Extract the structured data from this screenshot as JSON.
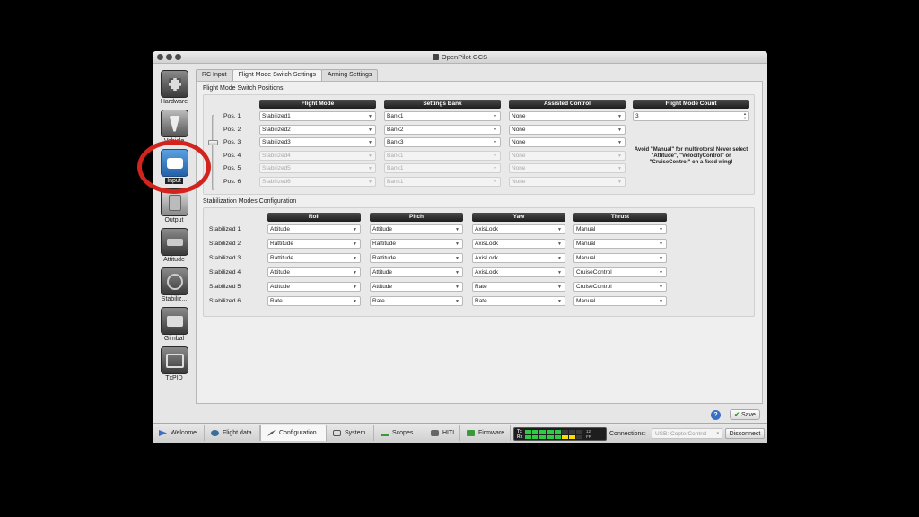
{
  "window": {
    "title": "OpenPilot GCS"
  },
  "sidebar": {
    "items": [
      {
        "label": "Hardware",
        "icon": "chip-icon"
      },
      {
        "label": "Vehicle",
        "icon": "vehicle-icon"
      },
      {
        "label": "Input",
        "icon": "remote-control-icon",
        "active": true
      },
      {
        "label": "Output",
        "icon": "motor-icon"
      },
      {
        "label": "Attitude",
        "icon": "attitude-icon"
      },
      {
        "label": "Stabiliz...",
        "icon": "gyro-icon"
      },
      {
        "label": "Gimbal",
        "icon": "camera-icon"
      },
      {
        "label": "TxPID",
        "icon": "pid-icon"
      }
    ]
  },
  "tabs": [
    "RC Input",
    "Flight Mode Switch Settings",
    "Arming Settings"
  ],
  "flight_mode": {
    "section_title": "Flight Mode Switch Positions",
    "headers": [
      "Flight Mode",
      "Settings Bank",
      "Assisted Control",
      "Flight Mode Count"
    ],
    "positions": [
      {
        "label": "Pos. 1",
        "mode": "Stabilized1",
        "bank": "Bank1",
        "assist": "None",
        "enabled": true
      },
      {
        "label": "Pos. 2",
        "mode": "Stabilized2",
        "bank": "Bank2",
        "assist": "None",
        "enabled": true
      },
      {
        "label": "Pos. 3",
        "mode": "Stabilized3",
        "bank": "Bank3",
        "assist": "None",
        "enabled": true
      },
      {
        "label": "Pos. 4",
        "mode": "Stabilized4",
        "bank": "Bank1",
        "assist": "None",
        "enabled": false
      },
      {
        "label": "Pos. 5",
        "mode": "Stabilized5",
        "bank": "Bank1",
        "assist": "None",
        "enabled": false
      },
      {
        "label": "Pos. 6",
        "mode": "Stabilized6",
        "bank": "Bank1",
        "assist": "None",
        "enabled": false
      }
    ],
    "count_value": "3",
    "note": "Avoid \"Manual\" for multirotors! Never select \"Attitude\", \"VelocityControl\" or \"CruiseControl\" on a fixed wing!"
  },
  "stabilization": {
    "section_title": "Stabilization Modes Configuration",
    "headers": [
      "Roll",
      "Pitch",
      "Yaw",
      "Thrust"
    ],
    "rows": [
      {
        "label": "Stabilized 1",
        "roll": "Attitude",
        "pitch": "Attitude",
        "yaw": "AxisLock",
        "thrust": "Manual"
      },
      {
        "label": "Stabilized 2",
        "roll": "Rattitude",
        "pitch": "Rattitude",
        "yaw": "AxisLock",
        "thrust": "Manual"
      },
      {
        "label": "Stabilized 3",
        "roll": "Rattitude",
        "pitch": "Rattitude",
        "yaw": "AxisLock",
        "thrust": "Manual"
      },
      {
        "label": "Stabilized 4",
        "roll": "Attitude",
        "pitch": "Attitude",
        "yaw": "AxisLock",
        "thrust": "CruiseControl"
      },
      {
        "label": "Stabilized 5",
        "roll": "Attitude",
        "pitch": "Attitude",
        "yaw": "Rate",
        "thrust": "CruiseControl"
      },
      {
        "label": "Stabilized 6",
        "roll": "Rate",
        "pitch": "Rate",
        "yaw": "Rate",
        "thrust": "Manual"
      }
    ]
  },
  "actions": {
    "help": "?",
    "save": "Save"
  },
  "bottom": {
    "modes": [
      {
        "label": "Welcome",
        "icon": "welcome-icon"
      },
      {
        "label": "Flight data",
        "icon": "flight-data-icon"
      },
      {
        "label": "Configuration",
        "icon": "configuration-icon",
        "active": true
      },
      {
        "label": "System",
        "icon": "system-icon"
      },
      {
        "label": "Scopes",
        "icon": "scopes-icon"
      },
      {
        "label": "HITL",
        "icon": "hitl-icon"
      },
      {
        "label": "Firmware",
        "icon": "firmware-icon"
      }
    ],
    "tx_label": "Tx",
    "rx_label": "Rx",
    "tx_num": "12",
    "rx_num": "FR",
    "connections_label": "Connections:",
    "connection_value": "USB: CopterControl",
    "disconnect": "Disconnect"
  },
  "colors": {
    "accent": "#2361a8",
    "annotation": "#d2231c",
    "header": "#1e1e1e"
  }
}
